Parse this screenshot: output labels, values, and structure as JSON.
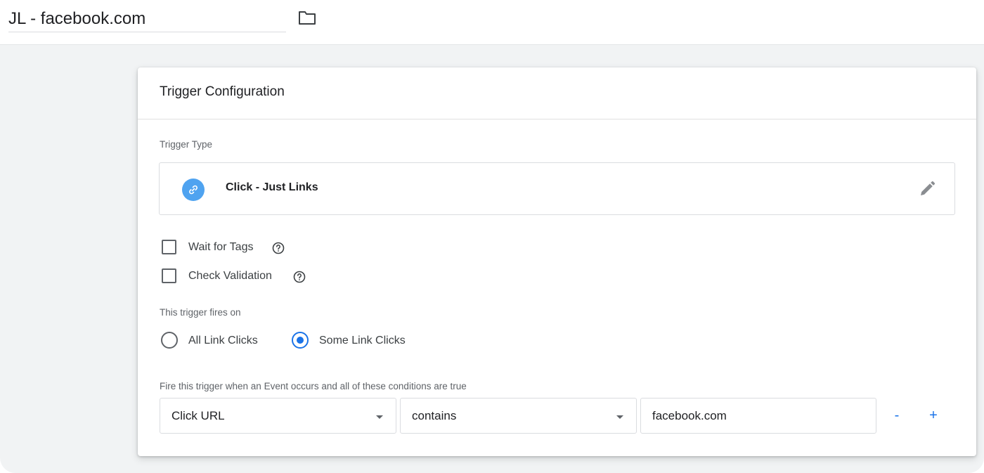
{
  "header": {
    "trigger_name": "JL - facebook.com",
    "folder_icon": "folder-icon"
  },
  "card": {
    "title": "Trigger Configuration",
    "trigger_type_label": "Trigger Type",
    "trigger_type": {
      "name": "Click - Just Links",
      "icon": "link-icon",
      "icon_color": "#4fa3f0",
      "edit_icon": "pencil-icon"
    },
    "options": {
      "wait_for_tags": {
        "label": "Wait for Tags",
        "checked": false,
        "help_icon": "help-circle-icon"
      },
      "check_validation": {
        "label": "Check Validation",
        "checked": false,
        "help_icon": "help-circle-icon"
      }
    },
    "fires_on_label": "This trigger fires on",
    "fires_on": {
      "options": [
        "All Link Clicks",
        "Some Link Clicks"
      ],
      "selected": "Some Link Clicks"
    },
    "conditions_label": "Fire this trigger when an Event occurs and all of these conditions are true",
    "condition": {
      "variable": "Click URL",
      "operator": "contains",
      "value": "facebook.com",
      "remove_label": "-",
      "add_label": "+"
    }
  },
  "colors": {
    "accent": "#1a73e8",
    "background": "#f1f3f4",
    "card": "#ffffff"
  }
}
